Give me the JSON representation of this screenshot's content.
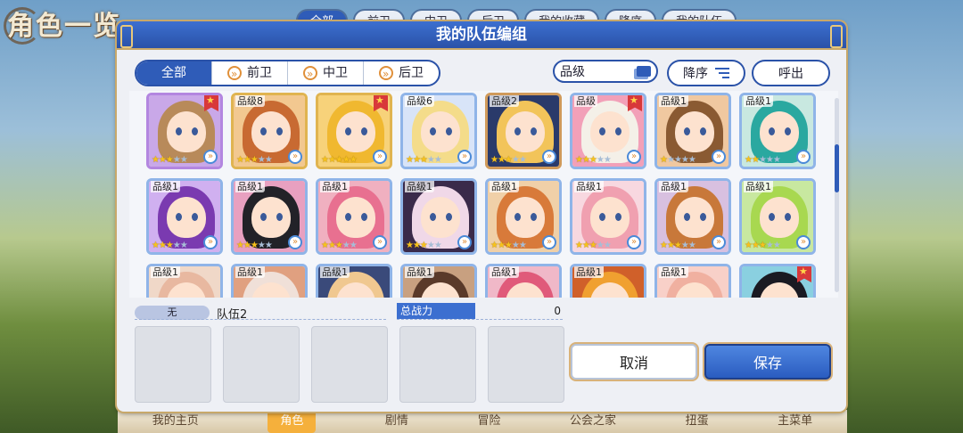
{
  "background": {
    "title": "角色一览",
    "tabs": [
      "全部",
      "前卫",
      "中卫",
      "后卫",
      "我的收藏",
      "降序",
      "我的队伍"
    ],
    "nav": [
      "我的主页",
      "角色",
      "剧情",
      "冒险",
      "公会之家",
      "扭蛋",
      "主菜单"
    ]
  },
  "dialog": {
    "title": "我的队伍编组",
    "filter_tabs": [
      "全部",
      "前卫",
      "中卫",
      "后卫"
    ],
    "rarity_label": "品级",
    "sort_label": "降序",
    "call_label": "呼出"
  },
  "characters": [
    {
      "level": "",
      "stars": 3,
      "rarity": "r-purple",
      "flag": true,
      "hair": "#b88a5a",
      "bg": "#c9a8e8"
    },
    {
      "level": "品级8",
      "stars": 3,
      "rarity": "r-gold",
      "flag": false,
      "hair": "#c86a32",
      "bg": "#f2c890"
    },
    {
      "level": "",
      "stars": 5,
      "rarity": "r-gold",
      "flag": true,
      "hair": "#f0b830",
      "bg": "#f7d27a"
    },
    {
      "level": "品级6",
      "stars": 3,
      "rarity": "r-blue",
      "flag": false,
      "hair": "#f4dc8a",
      "bg": "#d8e4f8"
    },
    {
      "level": "品级2",
      "stars": 3,
      "rarity": "r-bronze",
      "flag": false,
      "hair": "#f2c45a",
      "bg": "#2a3a6a"
    },
    {
      "level": "品级",
      "stars": 3,
      "rarity": "r-blue",
      "flag": true,
      "hair": "#f4f0e8",
      "bg": "#f2a0b8"
    },
    {
      "level": "品级1",
      "stars": 1,
      "rarity": "r-blue",
      "flag": false,
      "hair": "#8a5a32",
      "bg": "#f0c8a0"
    },
    {
      "level": "品级1",
      "stars": 2,
      "rarity": "r-blue",
      "flag": false,
      "hair": "#2aa8a0",
      "bg": "#c8e8e0"
    },
    {
      "level": "品级1",
      "stars": 3,
      "rarity": "r-blue",
      "flag": false,
      "hair": "#7a3ab0",
      "bg": "#d0b0f0"
    },
    {
      "level": "品级1",
      "stars": 3,
      "rarity": "r-blue",
      "flag": false,
      "hair": "#222228",
      "bg": "#e8a0c0"
    },
    {
      "level": "品级1",
      "stars": 3,
      "rarity": "r-blue",
      "flag": false,
      "hair": "#e87090",
      "bg": "#f0b0c0"
    },
    {
      "level": "品级1",
      "stars": 3,
      "rarity": "r-blue",
      "flag": false,
      "hair": "#f0d8e8",
      "bg": "#3a2a4a"
    },
    {
      "level": "品级1",
      "stars": 3,
      "rarity": "r-blue",
      "flag": false,
      "hair": "#d87a3a",
      "bg": "#f0d0a8"
    },
    {
      "level": "品级1",
      "stars": 3,
      "rarity": "r-blue",
      "flag": false,
      "hair": "#f0a0b0",
      "bg": "#f8d8e0"
    },
    {
      "level": "品级1",
      "stars": 3,
      "rarity": "r-blue",
      "flag": false,
      "hair": "#c8783a",
      "bg": "#d8c0e0"
    },
    {
      "level": "品级1",
      "stars": 3,
      "rarity": "r-blue",
      "flag": false,
      "hair": "#a8d850",
      "bg": "#c8e8a0"
    },
    {
      "level": "品级1",
      "stars": 0,
      "rarity": "r-blue",
      "flag": false,
      "hair": "#e8b8a0",
      "bg": "#f0d8c8"
    },
    {
      "level": "品级1",
      "stars": 0,
      "rarity": "r-blue",
      "flag": false,
      "hair": "#f0e0d8",
      "bg": "#e0a080"
    },
    {
      "level": "品级1",
      "stars": 0,
      "rarity": "r-blue",
      "flag": false,
      "hair": "#f0c890",
      "bg": "#3a4a7a"
    },
    {
      "level": "品级1",
      "stars": 0,
      "rarity": "r-blue",
      "flag": false,
      "hair": "#5a3a2a",
      "bg": "#c8a080"
    },
    {
      "level": "品级1",
      "stars": 0,
      "rarity": "r-blue",
      "flag": false,
      "hair": "#e05a7a",
      "bg": "#f0b8c8"
    },
    {
      "level": "品级1",
      "stars": 0,
      "rarity": "r-blue",
      "flag": false,
      "hair": "#f0a030",
      "bg": "#d0602a"
    },
    {
      "level": "品级1",
      "stars": 0,
      "rarity": "r-blue",
      "flag": false,
      "hair": "#f0b0a0",
      "bg": "#f8d0c8"
    },
    {
      "level": "",
      "stars": 0,
      "rarity": "r-blue",
      "flag": true,
      "hair": "#1a1a22",
      "bg": "#8ad0e0"
    }
  ],
  "team": {
    "tag": "无",
    "name": "队伍2",
    "power_label": "总战力",
    "power_value": "0"
  },
  "buttons": {
    "cancel": "取消",
    "save": "保存"
  }
}
